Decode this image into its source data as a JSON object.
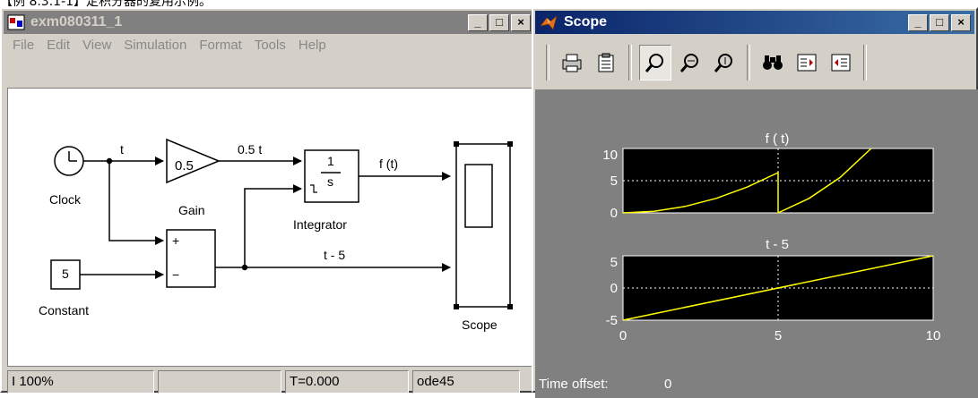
{
  "caption": "【例 8.3.1-1】定积分器的复用示例。",
  "model_window": {
    "title": "exm080311_1",
    "min_btn": "_",
    "max_btn": "□",
    "close_btn": "×",
    "menus": [
      "File",
      "Edit",
      "View",
      "Simulation",
      "Format",
      "Tools",
      "Help"
    ],
    "blocks": {
      "clock": "Clock",
      "gain_value": "0.5",
      "gain": "Gain",
      "integrator_num": "1",
      "integrator_den": "s",
      "integrator": "Integrator",
      "constant_value": "5",
      "constant": "Constant",
      "sum_plus": "+",
      "sum_minus": "−",
      "scope": "Scope"
    },
    "signals": {
      "t": "t",
      "half_t": "0.5 t",
      "ft": "f (t)",
      "t_minus_5": "t - 5"
    },
    "status": {
      "zoom": "I 100%",
      "time": "T=0.000",
      "solver": "ode45"
    }
  },
  "scope_window": {
    "title": "Scope",
    "min_btn": "_",
    "max_btn": "□",
    "close_btn": "×",
    "toolbar_icons": [
      "print-icon",
      "parameters-icon",
      "zoom-icon",
      "zoom-x-icon",
      "zoom-y-icon",
      "autoscale-icon",
      "save-axes-icon",
      "restore-axes-icon"
    ],
    "time_offset_label": "Time offset:",
    "time_offset_value": "0"
  },
  "chart_data": [
    {
      "type": "line",
      "title": "f ( t)",
      "x": [
        0,
        1,
        2,
        3,
        4,
        5,
        5,
        6,
        7,
        8
      ],
      "y": [
        0,
        0.25,
        1,
        2.25,
        4,
        6.25,
        0,
        2.25,
        5.5,
        10
      ],
      "xlim": [
        0,
        10
      ],
      "ylim": [
        0,
        10
      ],
      "yticks": [
        "10",
        "5",
        "0"
      ],
      "color": "#ffff00",
      "background": "#000000",
      "grid": true
    },
    {
      "type": "line",
      "title": "t - 5",
      "x": [
        0,
        10
      ],
      "y": [
        -5,
        5
      ],
      "xlim": [
        0,
        10
      ],
      "ylim": [
        -5,
        5
      ],
      "yticks": [
        "5",
        "0",
        "-5"
      ],
      "xticks": [
        "0",
        "5",
        "10"
      ],
      "color": "#ffff00",
      "background": "#000000",
      "grid": true
    }
  ]
}
